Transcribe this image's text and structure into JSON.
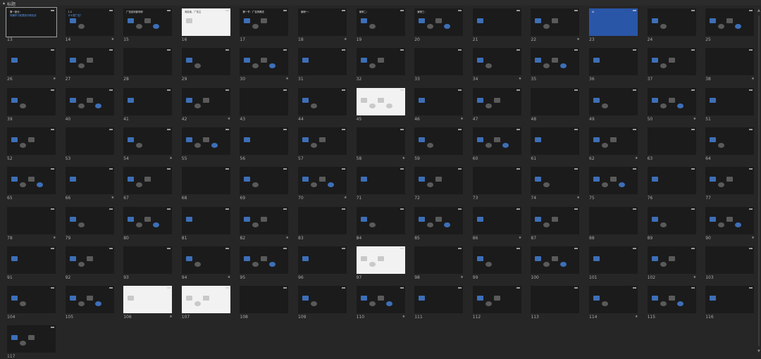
{
  "window": {
    "title": "标题"
  },
  "colors": {
    "background": "#262626",
    "slide_dark": "#1b1b1b",
    "slide_white": "#f2f2f2",
    "accent_red": "#c3261d",
    "accent_blue": "#2a56a8"
  },
  "slides": [
    {
      "num": "13",
      "title": "第一部分：",
      "sub": "传播学习前提探讨和实战",
      "style": "dark"
    },
    {
      "num": "14",
      "title": "1.1",
      "sub": "什么是广告？",
      "style": "dark"
    },
    {
      "num": "15",
      "title": "广告如何影响你",
      "style": "dark"
    },
    {
      "num": "16",
      "title": "消费者、广告主",
      "style": "white"
    },
    {
      "num": "17",
      "title": "第一节：广告的概念",
      "style": "dark"
    },
    {
      "num": "18",
      "title": "案例一：",
      "style": "dark"
    },
    {
      "num": "19",
      "title": "案例二：",
      "style": "dark"
    },
    {
      "num": "20",
      "title": "案例三：",
      "style": "dark"
    },
    {
      "num": "21",
      "title": "",
      "style": "dark"
    },
    {
      "num": "22",
      "title": "",
      "style": "dark"
    },
    {
      "num": "23",
      "title": "AI",
      "style": "blue"
    },
    {
      "num": "24",
      "title": "",
      "style": "dark"
    },
    {
      "num": "25",
      "title": "",
      "style": "dark"
    },
    {
      "num": "26",
      "title": "",
      "style": "dark"
    },
    {
      "num": "27",
      "title": "",
      "style": "dark"
    },
    {
      "num": "28",
      "title": "",
      "style": "dark"
    },
    {
      "num": "29",
      "title": "",
      "style": "dark"
    },
    {
      "num": "30",
      "title": "",
      "style": "dark"
    },
    {
      "num": "31",
      "title": "",
      "style": "dark"
    },
    {
      "num": "32",
      "title": "",
      "style": "dark"
    },
    {
      "num": "33",
      "title": "",
      "style": "dark"
    },
    {
      "num": "34",
      "title": "",
      "style": "dark"
    },
    {
      "num": "35",
      "title": "",
      "style": "dark"
    },
    {
      "num": "36",
      "title": "",
      "style": "dark"
    },
    {
      "num": "37",
      "title": "",
      "style": "dark"
    },
    {
      "num": "38",
      "title": "",
      "style": "dark"
    },
    {
      "num": "39",
      "title": "",
      "style": "dark"
    },
    {
      "num": "40",
      "title": "",
      "style": "dark"
    },
    {
      "num": "41",
      "title": "",
      "style": "dark"
    },
    {
      "num": "42",
      "title": "",
      "style": "dark"
    },
    {
      "num": "43",
      "title": "",
      "style": "dark"
    },
    {
      "num": "44",
      "title": "",
      "style": "dark"
    },
    {
      "num": "45",
      "title": "",
      "style": "white"
    },
    {
      "num": "46",
      "title": "",
      "style": "dark"
    },
    {
      "num": "47",
      "title": "",
      "style": "dark"
    },
    {
      "num": "48",
      "title": "",
      "style": "dark"
    },
    {
      "num": "49",
      "title": "",
      "style": "dark"
    },
    {
      "num": "50",
      "title": "",
      "style": "dark"
    },
    {
      "num": "51",
      "title": "",
      "style": "dark"
    },
    {
      "num": "52",
      "title": "",
      "style": "dark"
    },
    {
      "num": "53",
      "title": "",
      "style": "dark"
    },
    {
      "num": "54",
      "title": "",
      "style": "dark"
    },
    {
      "num": "55",
      "title": "",
      "style": "dark"
    },
    {
      "num": "56",
      "title": "",
      "style": "dark"
    },
    {
      "num": "57",
      "title": "",
      "style": "dark"
    },
    {
      "num": "58",
      "title": "",
      "style": "dark"
    },
    {
      "num": "59",
      "title": "",
      "style": "dark"
    },
    {
      "num": "60",
      "title": "",
      "style": "dark"
    },
    {
      "num": "61",
      "title": "",
      "style": "dark"
    },
    {
      "num": "62",
      "title": "",
      "style": "dark"
    },
    {
      "num": "63",
      "title": "",
      "style": "dark"
    },
    {
      "num": "64",
      "title": "",
      "style": "dark"
    },
    {
      "num": "65",
      "title": "",
      "style": "dark"
    },
    {
      "num": "66",
      "title": "",
      "style": "dark"
    },
    {
      "num": "67",
      "title": "",
      "style": "dark"
    },
    {
      "num": "68",
      "title": "",
      "style": "dark"
    },
    {
      "num": "69",
      "title": "",
      "style": "dark"
    },
    {
      "num": "70",
      "title": "",
      "style": "dark"
    },
    {
      "num": "71",
      "title": "",
      "style": "dark"
    },
    {
      "num": "72",
      "title": "",
      "style": "dark"
    },
    {
      "num": "73",
      "title": "",
      "style": "dark"
    },
    {
      "num": "74",
      "title": "",
      "style": "dark"
    },
    {
      "num": "75",
      "title": "",
      "style": "dark"
    },
    {
      "num": "76",
      "title": "",
      "style": "dark"
    },
    {
      "num": "77",
      "title": "",
      "style": "dark"
    },
    {
      "num": "78",
      "title": "",
      "style": "dark"
    },
    {
      "num": "79",
      "title": "",
      "style": "dark"
    },
    {
      "num": "80",
      "title": "",
      "style": "dark"
    },
    {
      "num": "81",
      "title": "",
      "style": "dark"
    },
    {
      "num": "82",
      "title": "",
      "style": "dark"
    },
    {
      "num": "83",
      "title": "",
      "style": "dark"
    },
    {
      "num": "84",
      "title": "",
      "style": "dark"
    },
    {
      "num": "85",
      "title": "",
      "style": "dark"
    },
    {
      "num": "86",
      "title": "",
      "style": "dark"
    },
    {
      "num": "87",
      "title": "",
      "style": "dark"
    },
    {
      "num": "88",
      "title": "",
      "style": "dark"
    },
    {
      "num": "89",
      "title": "",
      "style": "dark"
    },
    {
      "num": "90",
      "title": "",
      "style": "dark"
    },
    {
      "num": "91",
      "title": "",
      "style": "dark"
    },
    {
      "num": "92",
      "title": "",
      "style": "dark"
    },
    {
      "num": "93",
      "title": "",
      "style": "dark"
    },
    {
      "num": "94",
      "title": "",
      "style": "dark"
    },
    {
      "num": "95",
      "title": "",
      "style": "dark"
    },
    {
      "num": "96",
      "title": "",
      "style": "dark"
    },
    {
      "num": "97",
      "title": "",
      "style": "white"
    },
    {
      "num": "98",
      "title": "",
      "style": "dark"
    },
    {
      "num": "99",
      "title": "",
      "style": "dark"
    },
    {
      "num": "100",
      "title": "",
      "style": "dark"
    },
    {
      "num": "101",
      "title": "",
      "style": "dark"
    },
    {
      "num": "102",
      "title": "",
      "style": "dark"
    },
    {
      "num": "103",
      "title": "",
      "style": "dark"
    },
    {
      "num": "104",
      "title": "",
      "style": "dark"
    },
    {
      "num": "105",
      "title": "",
      "style": "dark"
    },
    {
      "num": "106",
      "title": "",
      "style": "white"
    },
    {
      "num": "107",
      "title": "",
      "style": "white"
    },
    {
      "num": "108",
      "title": "",
      "style": "dark"
    },
    {
      "num": "109",
      "title": "",
      "style": "dark"
    },
    {
      "num": "110",
      "title": "",
      "style": "dark"
    },
    {
      "num": "111",
      "title": "",
      "style": "dark"
    },
    {
      "num": "112",
      "title": "",
      "style": "dark"
    },
    {
      "num": "113",
      "title": "",
      "style": "dark"
    },
    {
      "num": "114",
      "title": "",
      "style": "dark"
    },
    {
      "num": "115",
      "title": "",
      "style": "dark"
    },
    {
      "num": "116",
      "title": "",
      "style": "dark"
    },
    {
      "num": "117",
      "title": "",
      "style": "dark"
    }
  ]
}
